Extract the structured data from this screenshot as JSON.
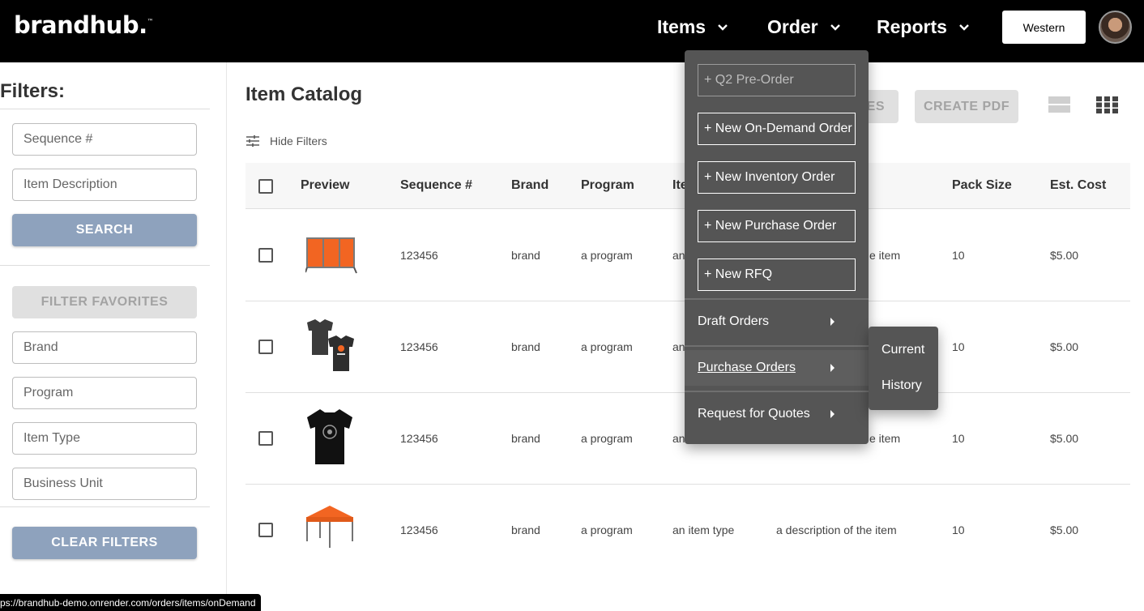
{
  "header": {
    "logo_main": "brandhub",
    "logo_dot": ".",
    "logo_tm": "™",
    "nav": [
      {
        "label": "Items"
      },
      {
        "label": "Order"
      },
      {
        "label": "Reports"
      }
    ],
    "territory_label": "Western"
  },
  "sidebar": {
    "title": "Filters:",
    "sequence_placeholder": "Sequence #",
    "description_placeholder": "Item Description",
    "search_label": "SEARCH",
    "filter_favorites_label": "FILTER FAVORITES",
    "brand_placeholder": "Brand",
    "program_placeholder": "Program",
    "item_type_placeholder": "Item Type",
    "business_unit_placeholder": "Business Unit",
    "clear_filters_label": "CLEAR FILTERS"
  },
  "main": {
    "title": "Item Catalog",
    "hide_filters_label": "Hide Filters",
    "partial_button_label": "ES",
    "create_pdf_label": "CREATE PDF",
    "columns": [
      "Preview",
      "Sequence #",
      "Brand",
      "Program",
      "Ite",
      "Pack Size",
      "Est. Cost"
    ],
    "rows": [
      {
        "preview": "orange-barricade-image",
        "sequence": "123456",
        "brand": "brand",
        "program": "a program",
        "item_type": "an",
        "description": "e item",
        "pack_size": "10",
        "cost": "$5.00"
      },
      {
        "preview": "gray-tshirts-image",
        "sequence": "123456",
        "brand": "brand",
        "program": "a program",
        "item_type": "an",
        "description": "",
        "pack_size": "10",
        "cost": "$5.00"
      },
      {
        "preview": "black-tshirt-image",
        "sequence": "123456",
        "brand": "brand",
        "program": "a program",
        "item_type": "an",
        "description": "e item",
        "pack_size": "10",
        "cost": "$5.00"
      },
      {
        "preview": "orange-tent-image",
        "sequence": "123456",
        "brand": "brand",
        "program": "a program",
        "item_type": "an item type",
        "description": "a description of the item",
        "pack_size": "10",
        "cost": "$5.00"
      }
    ]
  },
  "order_menu": {
    "buttons": [
      {
        "label": "+ Q2 Pre-Order",
        "disabled": true
      },
      {
        "label": "+ New On-Demand Order"
      },
      {
        "label": "+ New Inventory Order"
      },
      {
        "label": "+ New Purchase Order"
      },
      {
        "label": "+ New RFQ"
      }
    ],
    "items": [
      {
        "label": "Draft Orders"
      },
      {
        "label": "Purchase Orders"
      },
      {
        "label": "Request for Quotes"
      }
    ],
    "submenu": [
      {
        "label": "Current"
      },
      {
        "label": "History"
      }
    ]
  },
  "status_url": "ps://brandhub-demo.onrender.com/orders/items/onDemand",
  "colors": {
    "header_bg": "#000000",
    "menu_bg": "#555555",
    "accent_blue": "#8ea2bd",
    "disabled_gray": "#e0e0e0",
    "brand_orange": "#f26522"
  }
}
